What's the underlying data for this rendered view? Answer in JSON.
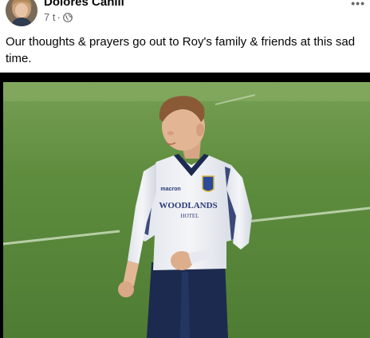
{
  "post": {
    "author": "Dolores Cahill",
    "time": "7 t",
    "separator": "·",
    "privacy_icon": "globe-icon",
    "more_icon": "more-options-icon",
    "more_label": "•••",
    "text": "Our thoughts & prayers go out to Roy's family & friends at this sad time."
  },
  "photo": {
    "shirt_sponsor": "WOODLANDS",
    "shirt_sponsor_sub": "HOTEL",
    "kit_brand": "macron"
  },
  "colors": {
    "text_primary": "#050505",
    "text_secondary": "#65676b",
    "pitch_green": "#5f8a3f",
    "shirt_white": "#eef0f5",
    "shorts_navy": "#1c2a4f"
  }
}
